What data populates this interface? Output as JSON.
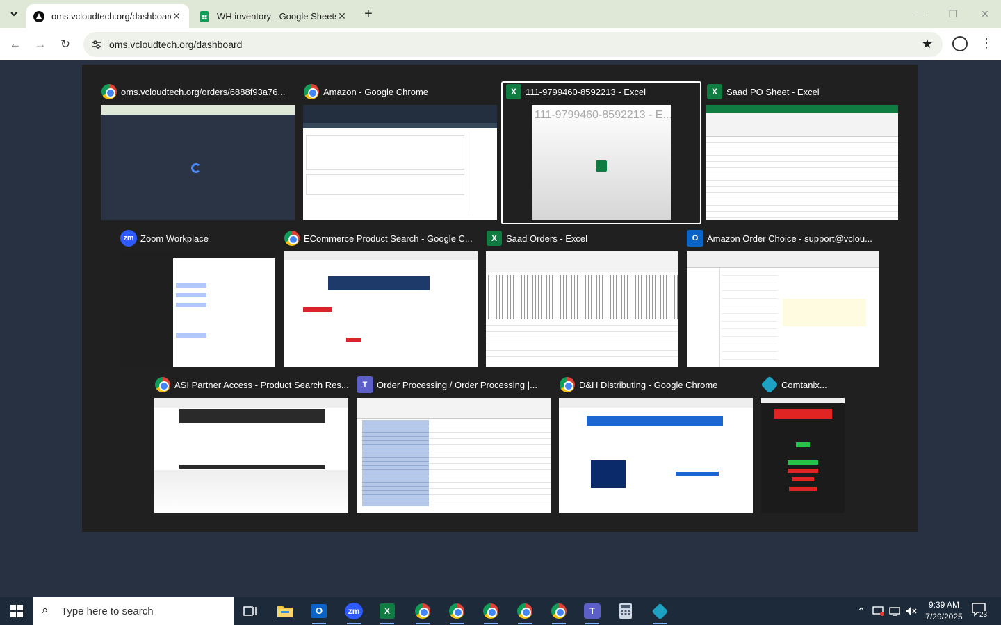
{
  "browser": {
    "tabs": [
      {
        "title": "oms.vcloudtech.org/dashboard",
        "active": true
      },
      {
        "title": "WH inventory - Google Sheets",
        "active": false
      }
    ],
    "url": "oms.vcloudtech.org/dashboard"
  },
  "switcher": {
    "windows": [
      {
        "title": "oms.vcloudtech.org/orders/6888f93a76...",
        "icon": "chrome-icon"
      },
      {
        "title": "Amazon - Google Chrome",
        "icon": "chrome-icon"
      },
      {
        "title": "111-9799460-8592213 - Excel",
        "icon": "excel-icon",
        "preview_text": "111-9799460-8592213 - E...",
        "selected": true
      },
      {
        "title": "Saad PO Sheet - Excel",
        "icon": "excel-icon"
      },
      {
        "title": "Zoom Workplace",
        "icon": "zoom-icon"
      },
      {
        "title": "ECommerce Product Search - Google C...",
        "icon": "chrome-icon"
      },
      {
        "title": "Saad Orders - Excel",
        "icon": "excel-icon"
      },
      {
        "title": "Amazon Order Choice - support@vclou...",
        "icon": "outlook-icon"
      },
      {
        "title": "ASI Partner Access - Product Search Res...",
        "icon": "chrome-icon"
      },
      {
        "title": "Order Processing / Order Processing |...",
        "icon": "teams-icon"
      },
      {
        "title": "D&H Distributing - Google Chrome",
        "icon": "chrome-icon"
      },
      {
        "title": "Comtanix...",
        "icon": "comtanix-icon"
      }
    ]
  },
  "taskbar": {
    "search_placeholder": "Type here to search",
    "time": "9:39 AM",
    "date": "7/29/2025",
    "notification_count": "23"
  },
  "colors": {
    "desktop_bg": "#273142",
    "switcher_bg": "#202020",
    "tabstrip_bg": "#dfe8d6",
    "taskbar_bg": "#1c2a3a",
    "excel_green": "#107c41"
  }
}
